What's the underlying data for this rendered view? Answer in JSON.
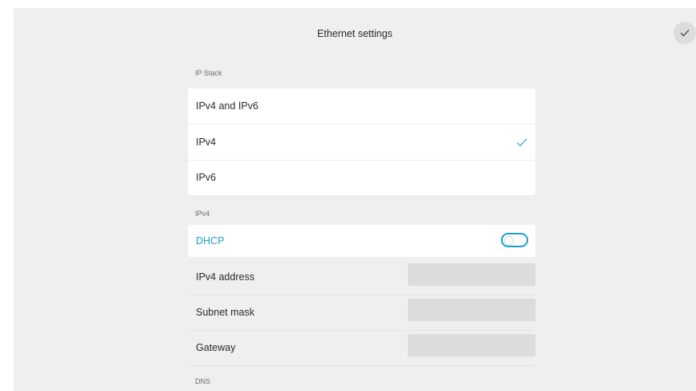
{
  "header": {
    "title": "Ethernet settings",
    "confirm_icon": "checkmark-icon"
  },
  "ip_stack": {
    "label": "IP Stack",
    "options": [
      {
        "label": "IPv4 and IPv6",
        "selected": false
      },
      {
        "label": "IPv4",
        "selected": true
      },
      {
        "label": "IPv6",
        "selected": false
      }
    ]
  },
  "ipv4": {
    "label": "IPv4",
    "dhcp": {
      "label": "DHCP",
      "enabled": false
    },
    "fields": [
      {
        "label": "IPv4 address",
        "value": ""
      },
      {
        "label": "Subnet mask",
        "value": ""
      },
      {
        "label": "Gateway",
        "value": ""
      }
    ]
  },
  "dns": {
    "label": "DNS"
  },
  "colors": {
    "accent": "#1fa0c6",
    "background": "#efefef",
    "field": "#dcdcdc"
  }
}
